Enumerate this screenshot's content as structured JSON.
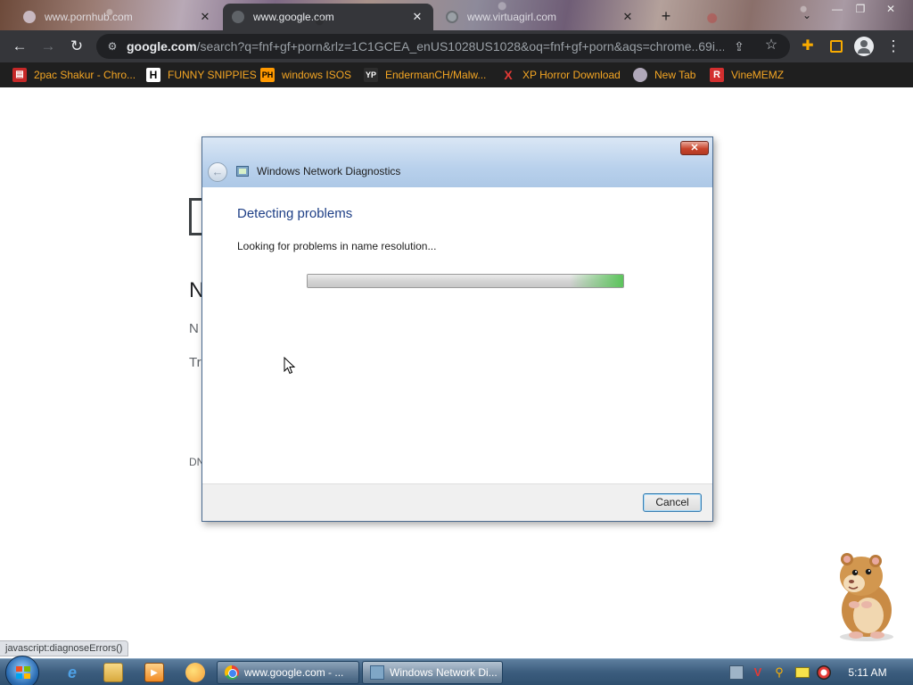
{
  "browser": {
    "tabs": [
      {
        "title": "www.pornhub.com",
        "active": false
      },
      {
        "title": "www.google.com",
        "active": true
      },
      {
        "title": "www.virtuagirl.com",
        "active": false
      }
    ],
    "window_controls": {
      "minimize": "—",
      "maximize": "❐",
      "close": "✕"
    },
    "new_tab_glyph": "+",
    "tab_search_glyph": "⌄",
    "toolbar": {
      "back_glyph": "←",
      "forward_glyph": "→",
      "reload_glyph": "↻",
      "menu_glyph": "⋮",
      "extensions_glyph": "✚"
    },
    "omnibox": {
      "host": "google.com",
      "path": "/search?q=fnf+gf+porn&rlz=1C1GCEA_enUS1028US1028&oq=fnf+gf+porn&aqs=chrome..69i...",
      "site_info_glyph": "⚙",
      "share_glyph": "⇪",
      "star_glyph": "☆"
    },
    "bookmarks": [
      {
        "label": "2pac Shakur - Chro...",
        "icon_text": "▤"
      },
      {
        "label": "FUNNY SNIPPIES",
        "icon_text": "H"
      },
      {
        "label": "windows ISOS",
        "icon_text": "PH"
      },
      {
        "label": "EndermanCH/Malw...",
        "icon_text": "YP"
      },
      {
        "label": "XP Horror Download",
        "icon_text": "X"
      },
      {
        "label": "New Tab",
        "icon_text": ""
      },
      {
        "label": "VineMEMZ",
        "icon_text": "R"
      }
    ],
    "status_bubble": "javascript:diagnoseErrors()"
  },
  "page_fragments": [
    "N",
    "N",
    "Tr",
    "DN"
  ],
  "dialog": {
    "title": "Windows Network Diagnostics",
    "close_glyph": "✕",
    "back_glyph": "←",
    "heading": "Detecting problems",
    "status": "Looking for problems in name resolution...",
    "progress": 1.0,
    "cancel_label": "Cancel"
  },
  "taskbar": {
    "tasks": [
      {
        "label": "www.google.com - ..."
      },
      {
        "label": "Windows Network Di..."
      }
    ],
    "quick_launch": {
      "ie_glyph": "e",
      "media_glyph": "▶"
    },
    "tray": {
      "v_glyph": "V",
      "search_glyph": "⚲"
    },
    "clock": "5:11 AM"
  },
  "colors": {
    "accent_link": "#f5a623",
    "dialog_heading": "#1e3f86",
    "progress_green": "#5cc45c"
  }
}
